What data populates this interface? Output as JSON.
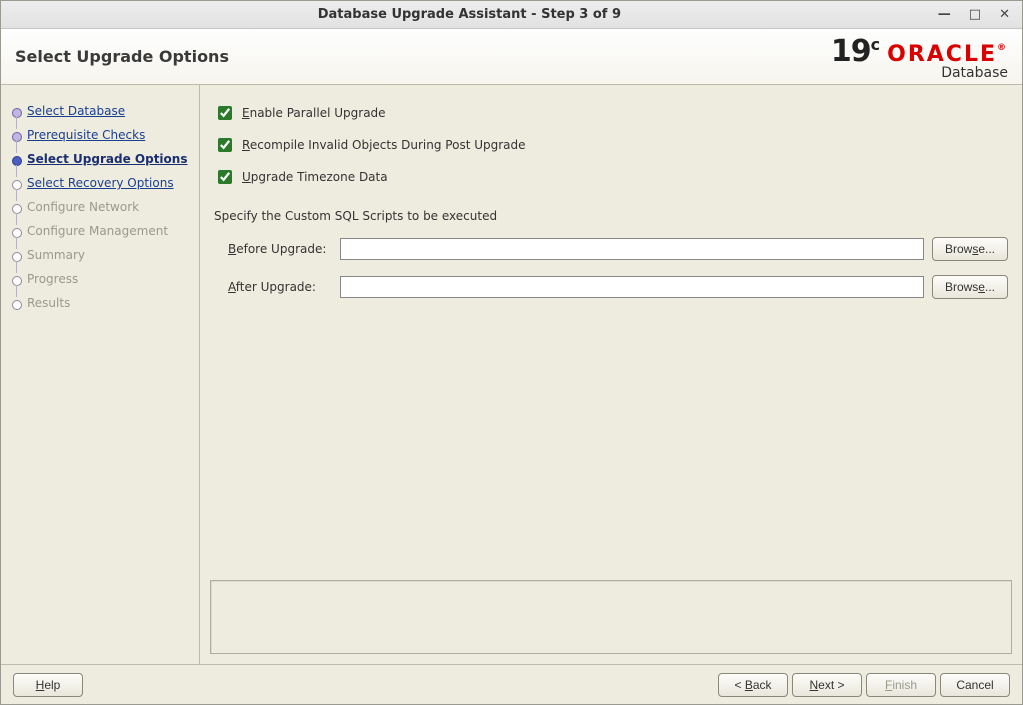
{
  "window": {
    "title": "Database Upgrade Assistant - Step 3 of 9"
  },
  "header": {
    "page_title": "Select Upgrade Options",
    "brand_version": "19",
    "brand_version_suffix": "c",
    "brand_name": "ORACLE",
    "brand_product": "Database"
  },
  "steps": [
    {
      "label": "Select Database",
      "state": "done",
      "link": true
    },
    {
      "label": "Prerequisite Checks",
      "state": "done",
      "link": true
    },
    {
      "label": "Select Upgrade Options",
      "state": "current",
      "link": true
    },
    {
      "label": "Select Recovery Options",
      "state": "upcoming",
      "link": true
    },
    {
      "label": "Configure Network",
      "state": "pending",
      "link": false
    },
    {
      "label": "Configure Management",
      "state": "pending",
      "link": false
    },
    {
      "label": "Summary",
      "state": "pending",
      "link": false
    },
    {
      "label": "Progress",
      "state": "pending",
      "link": false
    },
    {
      "label": "Results",
      "state": "pending",
      "link": false
    }
  ],
  "options": {
    "enable_parallel": {
      "label": "Enable Parallel Upgrade",
      "checked": true
    },
    "recompile_invalid": {
      "label": "Recompile Invalid Objects During Post Upgrade",
      "checked": true
    },
    "upgrade_timezone": {
      "label": "Upgrade Timezone Data",
      "checked": true
    }
  },
  "scripts": {
    "section_label": "Specify the Custom SQL Scripts to be executed",
    "before_label": "Before Upgrade:",
    "after_label": "After Upgrade:",
    "before_value": "",
    "after_value": "",
    "browse_label": "Browse..."
  },
  "footer": {
    "help": "Help",
    "back": "< Back",
    "next": "Next >",
    "finish": "Finish",
    "cancel": "Cancel"
  }
}
